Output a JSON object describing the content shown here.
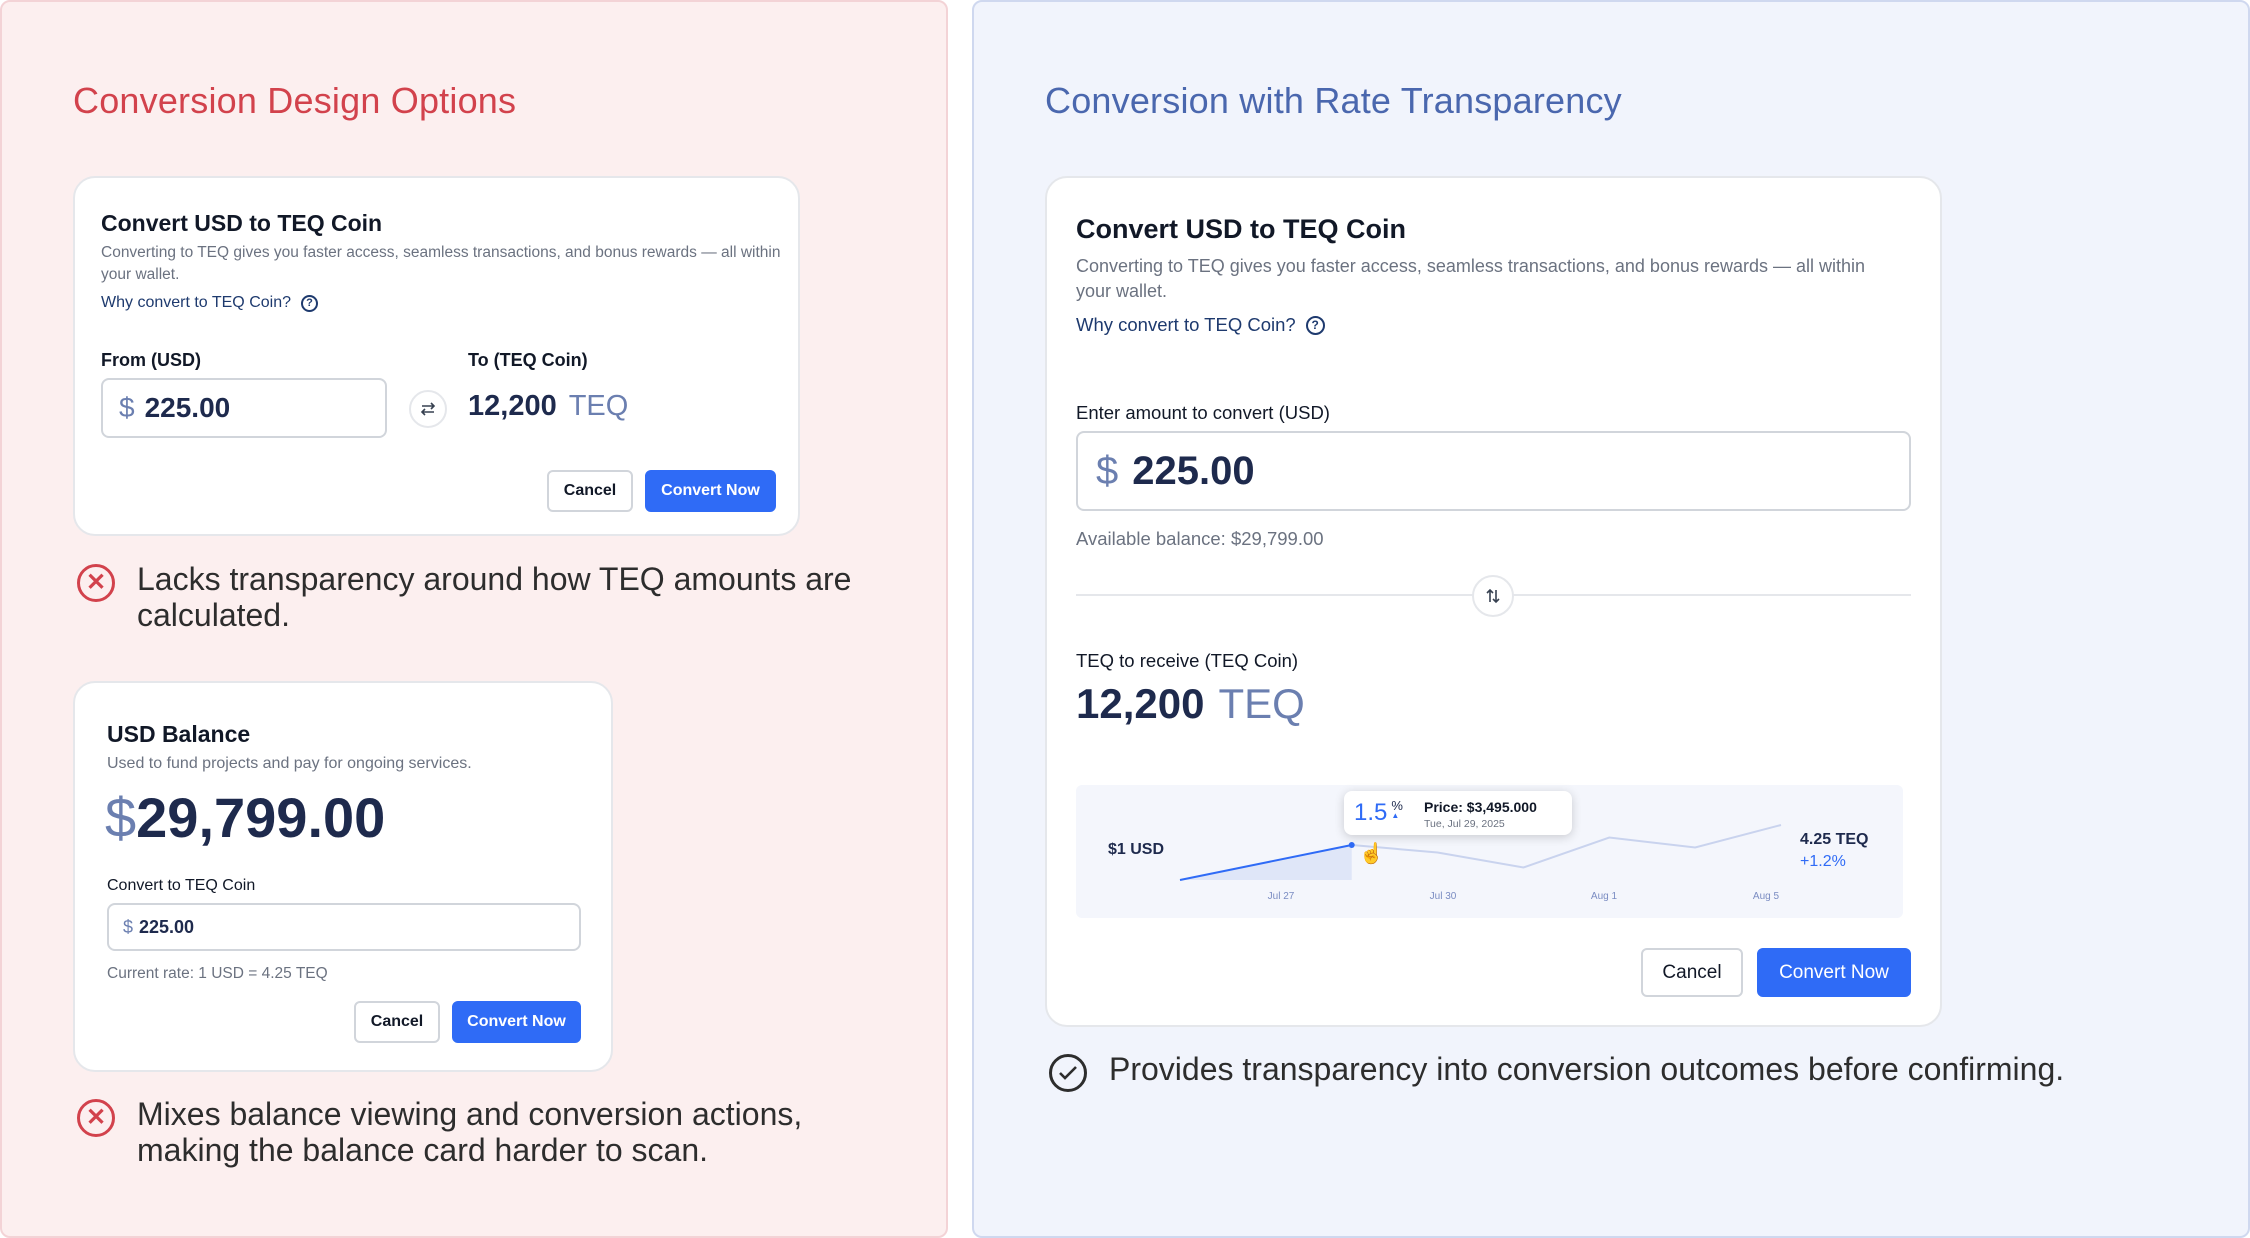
{
  "left_panel": {
    "title": "Conversion Design Options",
    "card1": {
      "title": "Convert USD to TEQ Coin",
      "desc": "Converting to TEQ gives you faster access, seamless transactions, and bonus rewards — all within your wallet.",
      "why": "Why convert to TEQ Coin?",
      "from_label": "From (USD)",
      "to_label": "To (TEQ Coin)",
      "currency": "$",
      "amount": "225.00",
      "teq_amount": "12,200",
      "teq_unit": "TEQ",
      "cancel": "Cancel",
      "convert": "Convert Now"
    },
    "note1": "Lacks transparency around how TEQ amounts are calculated.",
    "card2": {
      "title": "USD Balance",
      "desc": "Used to fund projects and pay for ongoing services.",
      "currency": "$",
      "balance": "29,799.00",
      "convert_label": "Convert to TEQ Coin",
      "input_currency": "$",
      "amount": "225.00",
      "rate": "Current rate: 1 USD = 4.25 TEQ",
      "cancel": "Cancel",
      "convert": "Convert Now"
    },
    "note2": "Mixes balance viewing and conversion actions, making the balance card harder to scan."
  },
  "right_panel": {
    "title": "Conversion with Rate Transparency",
    "card": {
      "title": "Convert USD to TEQ Coin",
      "desc": "Converting to TEQ gives you faster access, seamless transactions, and bonus rewards — all within your wallet.",
      "why": "Why convert to TEQ Coin?",
      "enter_label": "Enter amount to convert (USD)",
      "currency": "$",
      "amount": "225.00",
      "available": "Available balance: $29,799.00",
      "receive_label": "TEQ to receive (TEQ Coin)",
      "teq_amount": "12,200",
      "teq_unit": "TEQ",
      "cancel": "Cancel",
      "convert": "Convert Now"
    },
    "note": "Provides transparency into conversion outcomes before confirming."
  },
  "chart_data": {
    "type": "line",
    "left_label": "$1 USD",
    "right_value": "4.25 TEQ",
    "right_change": "+1.2%",
    "x_ticks": [
      "Jul 27",
      "Jul 30",
      "Aug 1",
      "Aug 5"
    ],
    "series": [
      {
        "values": [
          4.05,
          4.12,
          4.19,
          4.16,
          4.1,
          4.22,
          4.18,
          4.27
        ]
      }
    ],
    "highlighted_index": 2,
    "tooltip": {
      "percent": "1.5",
      "percent_sign": "%",
      "price": "Price: $3,495.000",
      "date": "Tue, Jul 29, 2025"
    }
  },
  "colors": {
    "accent": "#2f6bf6",
    "negative": "#d2424c",
    "left_bg": "#fcefef",
    "right_bg": "#f1f4fc"
  }
}
